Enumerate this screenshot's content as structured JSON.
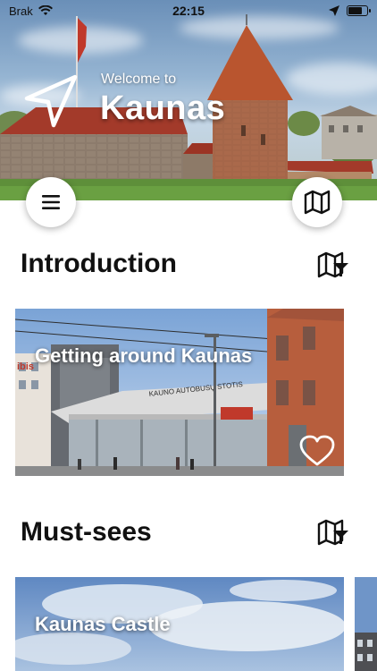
{
  "status_bar": {
    "carrier": "Brak",
    "time": "22:15",
    "battery_level": 0.75
  },
  "hero": {
    "subtitle": "Welcome to",
    "title": "Kaunas"
  },
  "sections": [
    {
      "title": "Introduction",
      "cards": [
        {
          "title": "Getting around Kaunas",
          "sign": "KAUNO AUTOBUSŲ STOTIS",
          "hotel_sign": "ibis"
        }
      ]
    },
    {
      "title": "Must-sees",
      "cards": [
        {
          "title": "Kaunas Castle"
        }
      ]
    }
  ],
  "icons": {
    "navigation": "navigation-arrow-icon",
    "menu": "hamburger-menu-icon",
    "map": "map-icon",
    "map_filter": "map-filter-icon",
    "favorite": "heart-outline-icon",
    "wifi": "wifi-icon",
    "location": "location-arrow-icon",
    "battery": "battery-icon"
  },
  "colors": {
    "text": "#111111",
    "fab_background": "#ffffff",
    "overlay_text": "#ffffff"
  }
}
